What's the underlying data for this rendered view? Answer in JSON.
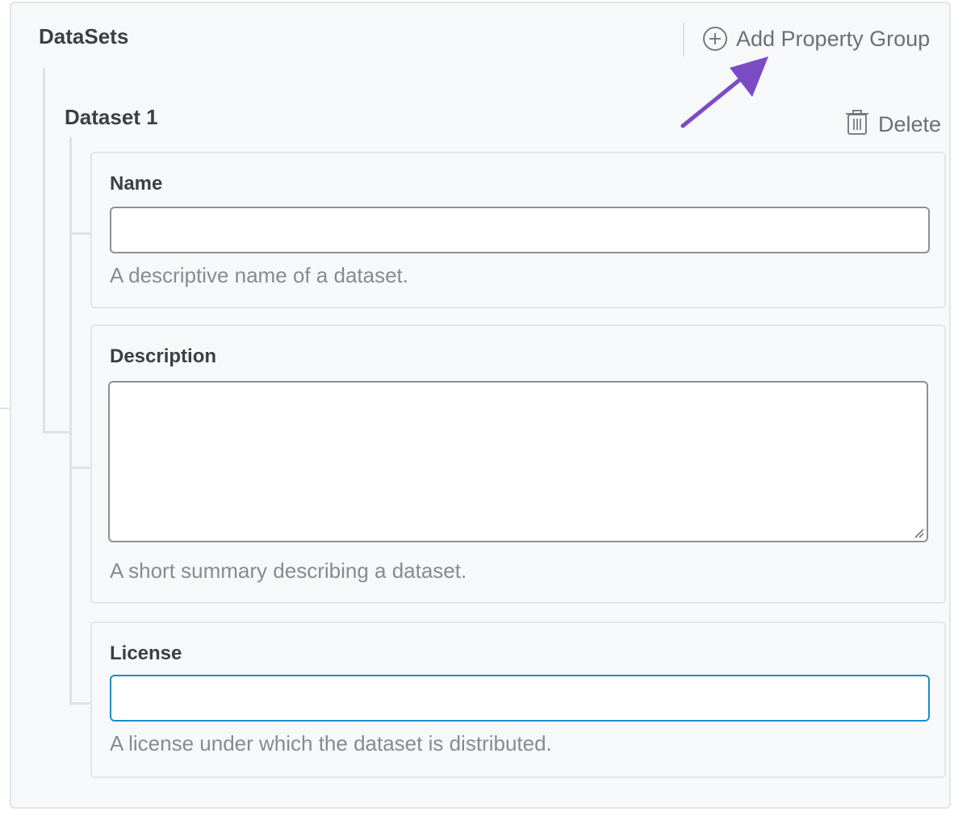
{
  "section": {
    "title": "DataSets",
    "add_group_label": "Add Property Group"
  },
  "dataset": {
    "title": "Dataset 1",
    "delete_label": "Delete"
  },
  "fields": {
    "name": {
      "label": "Name",
      "value": "",
      "help": "A descriptive name of a dataset."
    },
    "description": {
      "label": "Description",
      "value": "",
      "help": "A short summary describing a dataset."
    },
    "license": {
      "label": "License",
      "value": "",
      "help": "A license under which the dataset is distributed."
    }
  },
  "colors": {
    "annotation_arrow": "#7b4bc4",
    "focus_border": "#1e8cc8",
    "panel_background": "#f7f8fa"
  },
  "icons": {
    "add": "plus-circle-icon",
    "delete": "trash-icon",
    "annotation": "arrow-pointer-icon"
  }
}
